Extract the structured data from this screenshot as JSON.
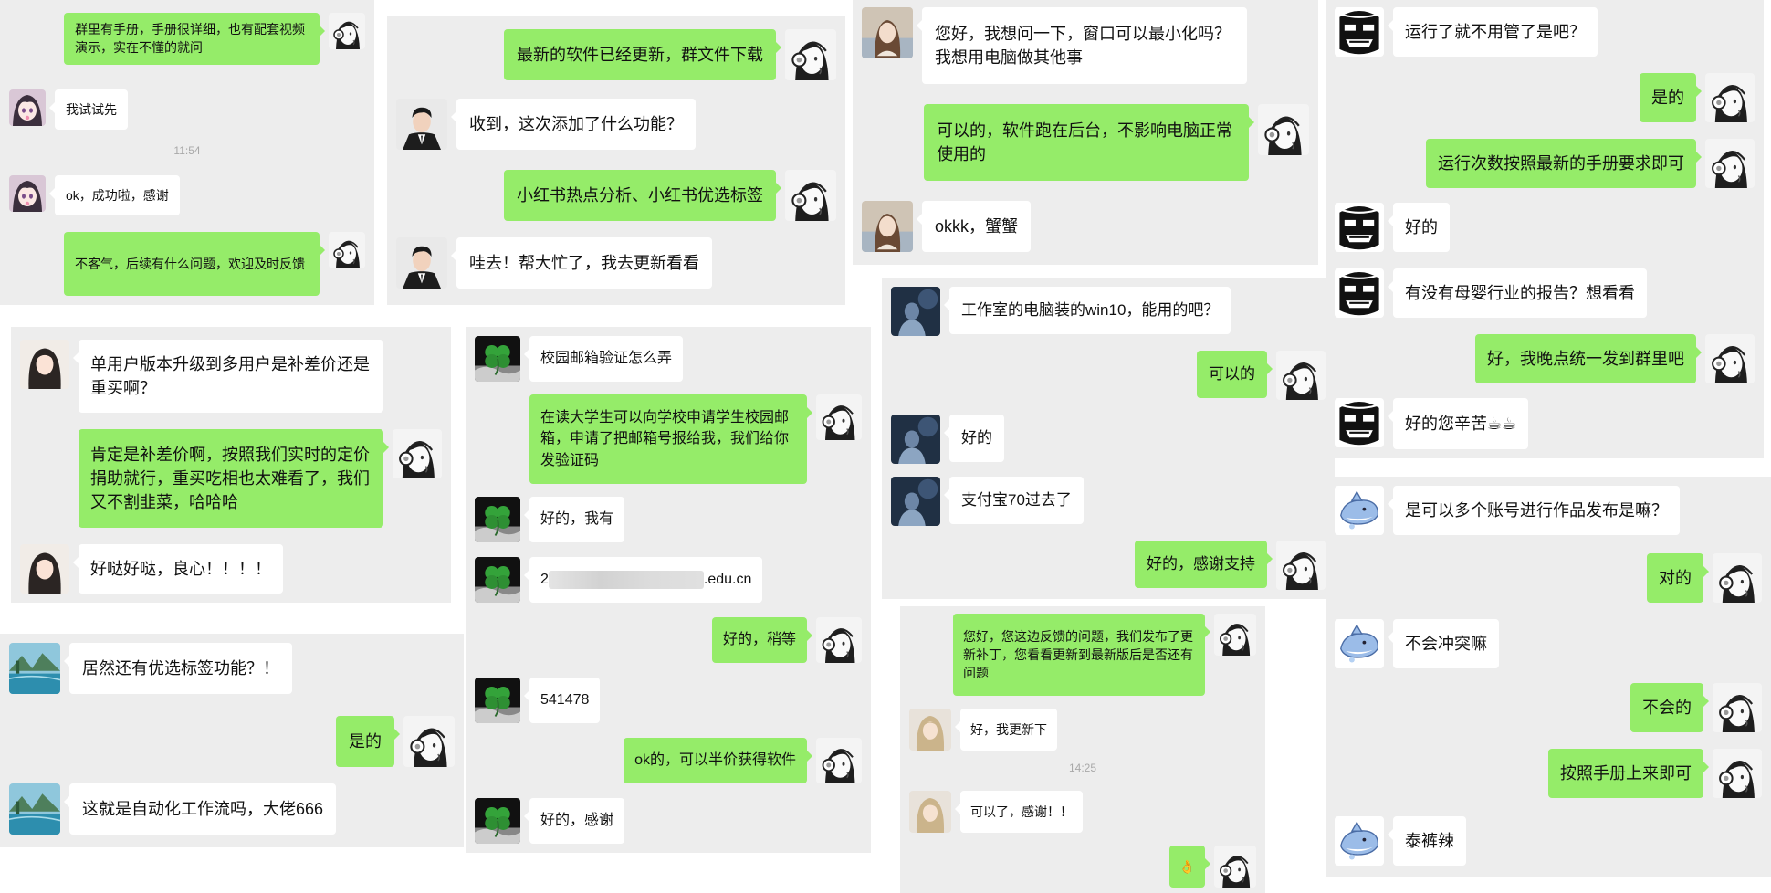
{
  "panels": [
    {
      "id": "p1",
      "messages": [
        {
          "side": "out",
          "text": "群里有手册，手册很详细，也有配套视频演示，实在不懂的就问"
        },
        {
          "side": "in",
          "text": "我试试先"
        },
        {
          "type": "time",
          "text": "11:54"
        },
        {
          "side": "in",
          "text": "ok，成功啦，感谢"
        },
        {
          "side": "out",
          "text": "不客气，后续有什么问题，欢迎及时反馈"
        }
      ]
    },
    {
      "id": "p2",
      "messages": [
        {
          "side": "out",
          "text": "最新的软件已经更新，群文件下载"
        },
        {
          "side": "in",
          "text": "收到，这次添加了什么功能？"
        },
        {
          "side": "out",
          "text": "小红书热点分析、小红书优选标签"
        },
        {
          "side": "in",
          "text": "哇去！帮大忙了，我去更新看看"
        }
      ]
    },
    {
      "id": "p3",
      "messages": [
        {
          "side": "in",
          "text": "您好，我想问一下，窗口可以最小化吗？我想用电脑做其他事"
        },
        {
          "side": "out",
          "text": "可以的，软件跑在后台，不影响电脑正常使用的"
        },
        {
          "side": "in",
          "text": "okkk，蟹蟹"
        }
      ]
    },
    {
      "id": "p4",
      "messages": [
        {
          "side": "in",
          "text": "运行了就不用管了是吧？"
        },
        {
          "side": "out",
          "text": "是的"
        },
        {
          "side": "out",
          "text": "运行次数按照最新的手册要求即可"
        },
        {
          "side": "in",
          "text": "好的"
        },
        {
          "side": "in",
          "text": "有没有母婴行业的报告？想看看"
        },
        {
          "side": "out",
          "text": "好，我晚点统一发到群里吧"
        },
        {
          "side": "in",
          "text": "好的您辛苦☕☕"
        }
      ]
    },
    {
      "id": "p5",
      "messages": [
        {
          "side": "in",
          "text": "单用户版本升级到多用户是补差价还是重买啊？"
        },
        {
          "side": "out",
          "text": "肯定是补差价啊，按照我们实时的定价捐助就行，重买吃相也太难看了，我们又不割韭菜，哈哈哈"
        },
        {
          "side": "in",
          "text": "好哒好哒，良心！！！！"
        }
      ]
    },
    {
      "id": "p6",
      "messages": [
        {
          "side": "in",
          "text": "校园邮箱验证怎么弄"
        },
        {
          "side": "out",
          "text": "在读大学生可以向学校申请学生校园邮箱，申请了把邮箱号报给我，我们给你发验证码"
        },
        {
          "side": "in",
          "text": "好的，我有"
        },
        {
          "side": "in",
          "text_prefix": "2",
          "text_suffix": ".edu.cn"
        },
        {
          "side": "out",
          "text": "好的，稍等"
        },
        {
          "side": "in",
          "text": "541478"
        },
        {
          "side": "out",
          "text": "ok的，可以半价获得软件"
        },
        {
          "side": "in",
          "text": "好的，感谢"
        }
      ]
    },
    {
      "id": "p7",
      "messages": [
        {
          "side": "in",
          "text": "工作室的电脑装的win10，能用的吧？"
        },
        {
          "side": "out",
          "text": "可以的"
        },
        {
          "side": "in",
          "text": "好的"
        },
        {
          "side": "in",
          "text": "支付宝70过去了"
        },
        {
          "side": "out",
          "text": "好的，感谢支持"
        }
      ]
    },
    {
      "id": "p8",
      "messages": [
        {
          "side": "in",
          "text": "居然还有优选标签功能？！"
        },
        {
          "side": "out",
          "text": "是的"
        },
        {
          "side": "in",
          "text": "这就是自动化工作流吗，大佬666"
        }
      ]
    },
    {
      "id": "p9",
      "messages": [
        {
          "side": "out",
          "text": "您好，您这边反馈的问题，我们发布了更新补丁，您看看更新到最新版后是否还有问题"
        },
        {
          "side": "in",
          "text": "好，我更新下"
        },
        {
          "type": "time",
          "text": "14:25"
        },
        {
          "side": "in",
          "text": "可以了，感谢！！"
        },
        {
          "side": "out",
          "text": "👌"
        }
      ]
    },
    {
      "id": "p10",
      "messages": [
        {
          "side": "in",
          "text": "是可以多个账号进行作品发布是嘛？"
        },
        {
          "side": "out",
          "text": "对的"
        },
        {
          "side": "in",
          "text": "不会冲突嘛"
        },
        {
          "side": "out",
          "text": "不会的"
        },
        {
          "side": "out",
          "text": "按照手册上来即可"
        },
        {
          "side": "in",
          "text": "泰裤辣"
        }
      ]
    }
  ]
}
